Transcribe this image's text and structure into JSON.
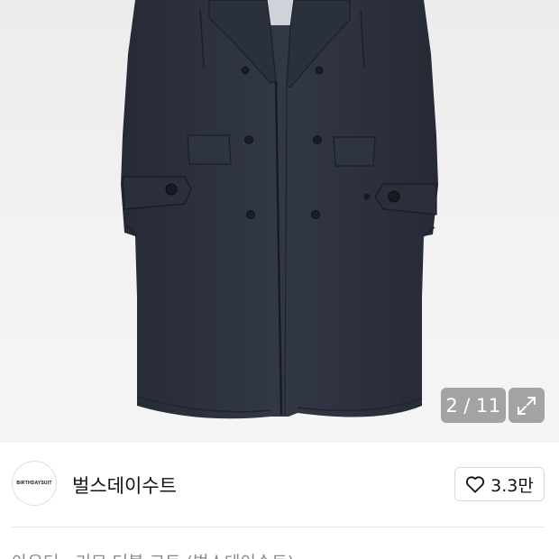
{
  "gallery": {
    "current": "2",
    "separator": "/",
    "total": "11",
    "expand_icon": "expand-arrows-icon",
    "image_subject": "navy-double-breasted-overcoat"
  },
  "brand": {
    "logo_text": "BIRTHDAYSUIT",
    "name": "벌스데이수트"
  },
  "like": {
    "icon": "heart-outline-icon",
    "count": "3.3만"
  },
  "product": {
    "title_partial": "아우터 · 기모 더블 코트 (벌스데이수트)"
  },
  "colors": {
    "coat": "#2d3240",
    "background": "#efefef",
    "badge": "#8c8c8c"
  }
}
